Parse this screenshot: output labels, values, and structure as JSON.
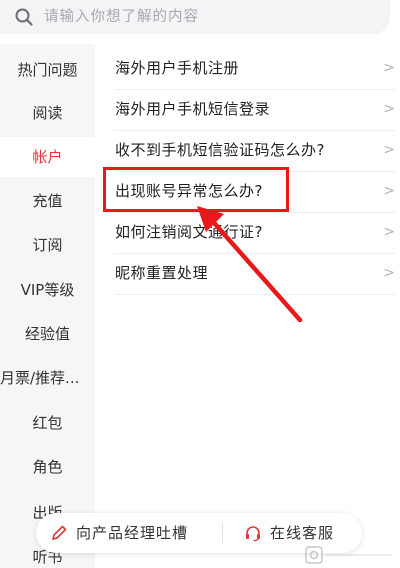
{
  "search": {
    "placeholder": "请输入你想了解的内容",
    "icon": "search-icon"
  },
  "sidebar": {
    "items": [
      {
        "label": "热门问题"
      },
      {
        "label": "阅读"
      },
      {
        "label": "帐户",
        "active": true
      },
      {
        "label": "充值"
      },
      {
        "label": "订阅"
      },
      {
        "label": "VIP等级"
      },
      {
        "label": "经验值"
      },
      {
        "label": "月票/推荐..."
      },
      {
        "label": "红包"
      },
      {
        "label": "角色"
      },
      {
        "label": "出版"
      },
      {
        "label": "听书"
      }
    ],
    "active_color": "#e0373a"
  },
  "questions": [
    {
      "label": "海外用户手机注册"
    },
    {
      "label": "海外用户手机短信登录"
    },
    {
      "label": "收不到手机短信验证码怎么办?"
    },
    {
      "label": "出现账号异常怎么办?",
      "highlighted": true
    },
    {
      "label": "如何注销阅文通行证?"
    },
    {
      "label": "昵称重置处理"
    }
  ],
  "chevron": ">",
  "annotation": {
    "highlight_color": "#e8181b",
    "target": "出现账号异常怎么办?"
  },
  "bottom_bar": {
    "feedback_label": "向产品经理吐槽",
    "service_label": "在线客服",
    "accent": "#e0373a"
  }
}
